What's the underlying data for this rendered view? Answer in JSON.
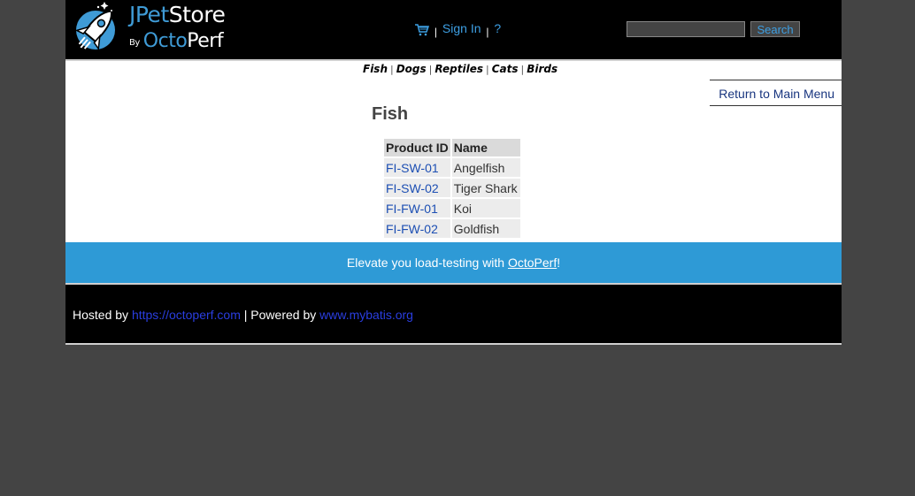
{
  "header": {
    "logo_line1_a": "J",
    "logo_line1_b": "Pet",
    "logo_line1_c": "Store",
    "logo_by": "By",
    "logo_line2_a": "Octo",
    "logo_line2_b": "Perf",
    "signin_label": "Sign In",
    "help_label": "?",
    "separator": "|",
    "search_placeholder": "",
    "search_button": "Search"
  },
  "quicklinks": [
    "Fish",
    "Dogs",
    "Reptiles",
    "Cats",
    "Birds"
  ],
  "main": {
    "back_link": "Return to Main Menu",
    "category_title": "Fish",
    "table": {
      "headers": [
        "Product ID",
        "Name"
      ],
      "rows": [
        [
          "FI-SW-01",
          "Angelfish"
        ],
        [
          "FI-SW-02",
          "Tiger Shark"
        ],
        [
          "FI-FW-01",
          "Koi"
        ],
        [
          "FI-FW-02",
          "Goldfish"
        ]
      ]
    }
  },
  "promo": {
    "prefix": "Elevate you load-testing with ",
    "link": "OctoPerf",
    "suffix": "!"
  },
  "footer": {
    "hosted_by": "Hosted by ",
    "hosted_link": "https://octoperf.com",
    "powered_by": " | Powered by ",
    "powered_link": "www.mybatis.org"
  },
  "colors": {
    "accent_blue": "#2e9ad6",
    "link_blue": "#3d9fe3",
    "background": "#444444"
  },
  "icons": [
    "rocket-logo-icon",
    "cart-icon"
  ]
}
